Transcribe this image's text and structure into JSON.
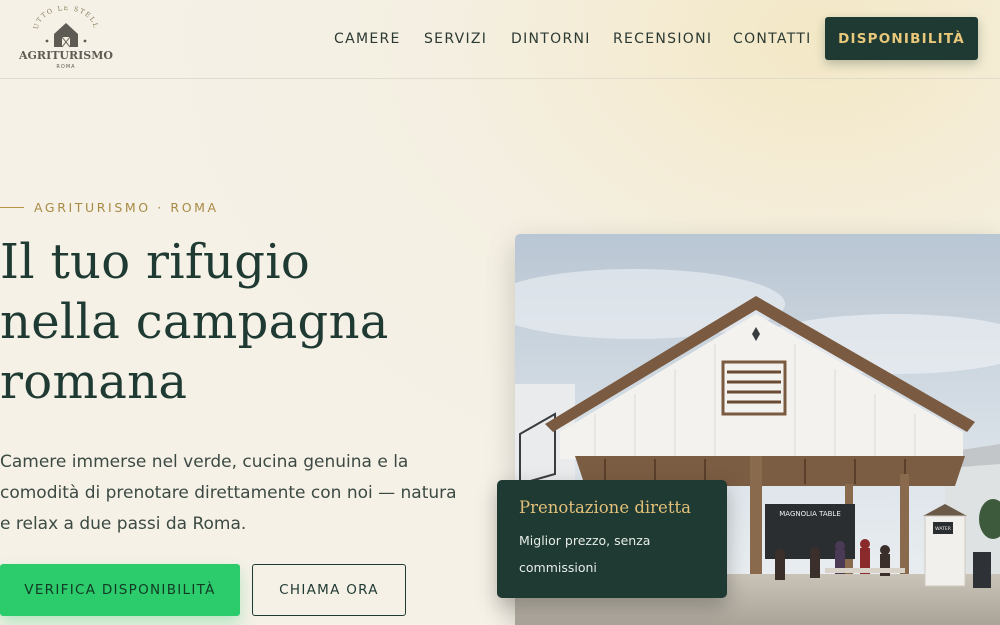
{
  "brand": {
    "arc_text": "TUTTO LE STELLE",
    "name": "AGRITURISMO",
    "city": "ROMA",
    "icon": "barn-icon"
  },
  "nav": {
    "items": [
      "CAMERE",
      "SERVIZI",
      "DINTORNI",
      "RECENSIONI",
      "CONTATTI"
    ],
    "cta_label": "DISPONIBILITÀ"
  },
  "hero": {
    "eyebrow": "AGRITURISMO · ROMA",
    "title_lines": [
      "Il tuo rifugio",
      "nella campagna",
      "romana"
    ],
    "subtitle": "Camere immerse nel verde, cucina genuina e la comodità di prenotare direttamente con noi — natura e relax a due passi da Roma.",
    "primary_button": "VERIFICA DISPONIBILITÀ",
    "secondary_button": "CHIAMA ORA"
  },
  "photo": {
    "signs": [
      "MAGNOLIA TABLE",
      "WATER"
    ]
  },
  "booking_card": {
    "title": "Prenotazione diretta",
    "text": "Miglior prezzo, senza commissioni"
  },
  "colors": {
    "forest": "#1f3a32",
    "gold": "#e2c07a",
    "green_cta": "#2ccb6c",
    "cream": "#f5f1e7"
  }
}
